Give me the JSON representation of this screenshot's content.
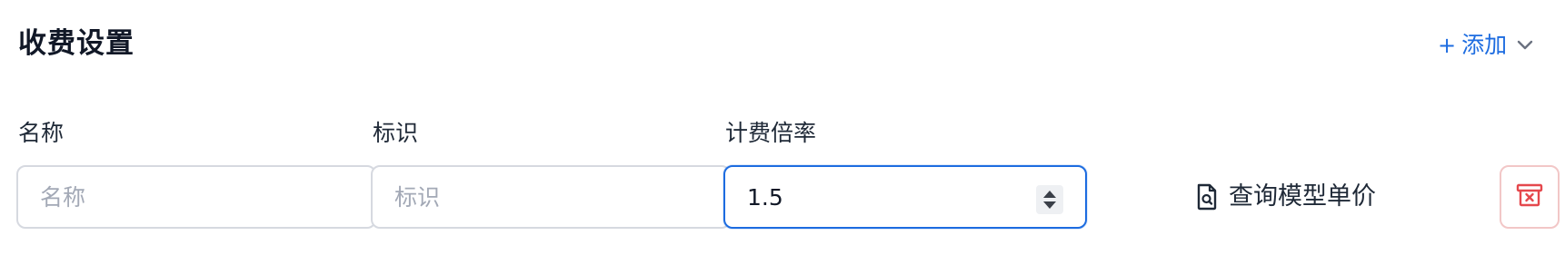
{
  "header": {
    "title": "收费设置",
    "add_label": "添加",
    "add_icon": "plus-icon",
    "dropdown_icon": "chevron-down-icon"
  },
  "fields": {
    "name": {
      "label": "名称",
      "placeholder": "名称",
      "value": ""
    },
    "identifier": {
      "label": "标识",
      "placeholder": "标识",
      "value": ""
    },
    "rate": {
      "label": "计费倍率",
      "value": "1.5"
    }
  },
  "actions": {
    "query_label": "查询模型单价",
    "query_icon": "file-search-icon",
    "delete_icon": "archive-x-icon"
  },
  "colors": {
    "accent": "#1d6ce0",
    "danger": "#e5484d",
    "danger_border": "#f2c7c7",
    "border": "#d6d9e0",
    "placeholder": "#a3a9b6"
  }
}
